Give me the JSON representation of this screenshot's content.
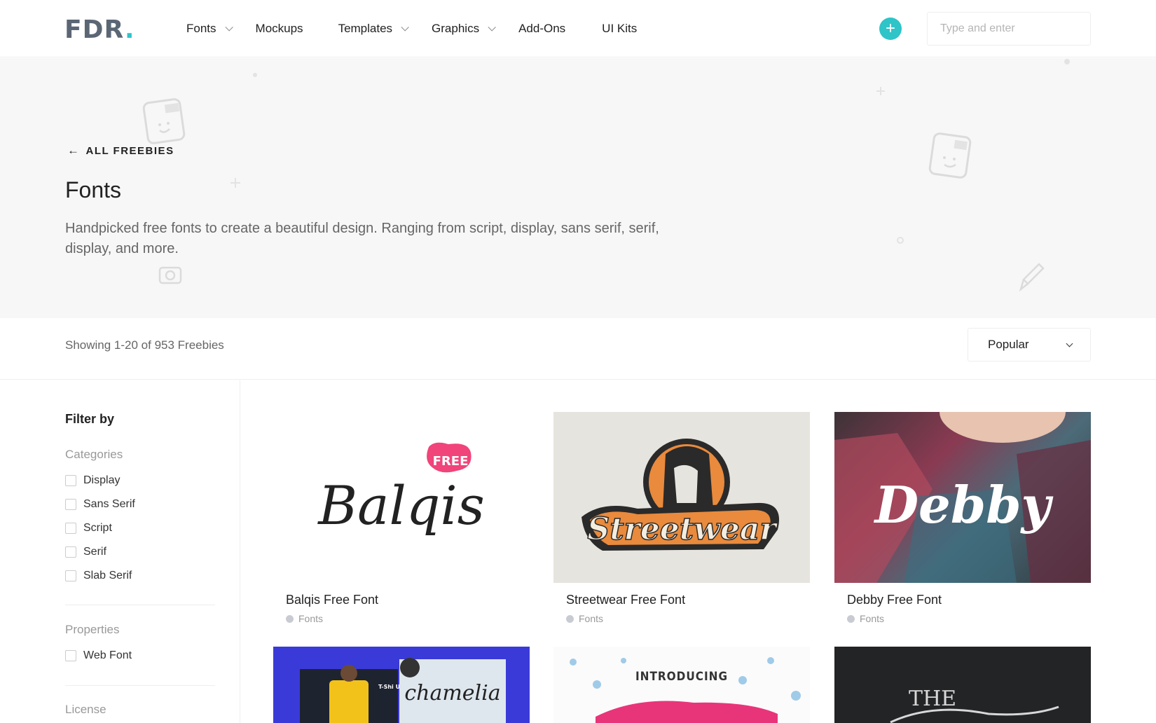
{
  "brand": {
    "logo_text": "FDR",
    "logo_dot": "."
  },
  "nav": {
    "items": [
      {
        "label": "Fonts",
        "dropdown": true
      },
      {
        "label": "Mockups",
        "dropdown": false
      },
      {
        "label": "Templates",
        "dropdown": true
      },
      {
        "label": "Graphics",
        "dropdown": true
      },
      {
        "label": "Add-Ons",
        "dropdown": false
      },
      {
        "label": "UI Kits",
        "dropdown": false
      }
    ],
    "add_icon": "plus-icon",
    "search_placeholder": "Type and enter"
  },
  "hero": {
    "back_label": "ALL FREEBIES",
    "title": "Fonts",
    "description": "Handpicked free fonts to create a beautiful design. Ranging from script, display, sans serif, serif, display, and more."
  },
  "toolbar": {
    "count_text": "Showing 1-20 of 953 Freebies",
    "sort_value": "Popular"
  },
  "sidebar": {
    "title": "Filter by",
    "categories": {
      "title": "Categories",
      "options": [
        "Display",
        "Sans Serif",
        "Script",
        "Serif",
        "Slab Serif"
      ]
    },
    "properties": {
      "title": "Properties",
      "options": [
        "Web Font"
      ]
    },
    "license": {
      "title": "License"
    }
  },
  "cards": [
    {
      "title": "Balqis Free Font",
      "category": "Fonts",
      "art_text": "Balqis",
      "badge": "FREE"
    },
    {
      "title": "Streetwear Free Font",
      "category": "Fonts",
      "art_text": "Streetwear"
    },
    {
      "title": "Debby Free Font",
      "category": "Fonts",
      "art_text": "Debby"
    },
    {
      "title": "",
      "category": "",
      "art_text": "chamelia",
      "art_subtext": "T-Shi Urban"
    },
    {
      "title": "",
      "category": "",
      "art_text": "INTRODUCING"
    },
    {
      "title": "",
      "category": "",
      "art_text": "THE"
    }
  ],
  "colors": {
    "accent": "#2ec4c8",
    "logo_gray": "#5b6675",
    "hero_bg": "#f7f7f8",
    "badge_pink": "#f0447a",
    "card4_blue": "#3a3ad8"
  }
}
